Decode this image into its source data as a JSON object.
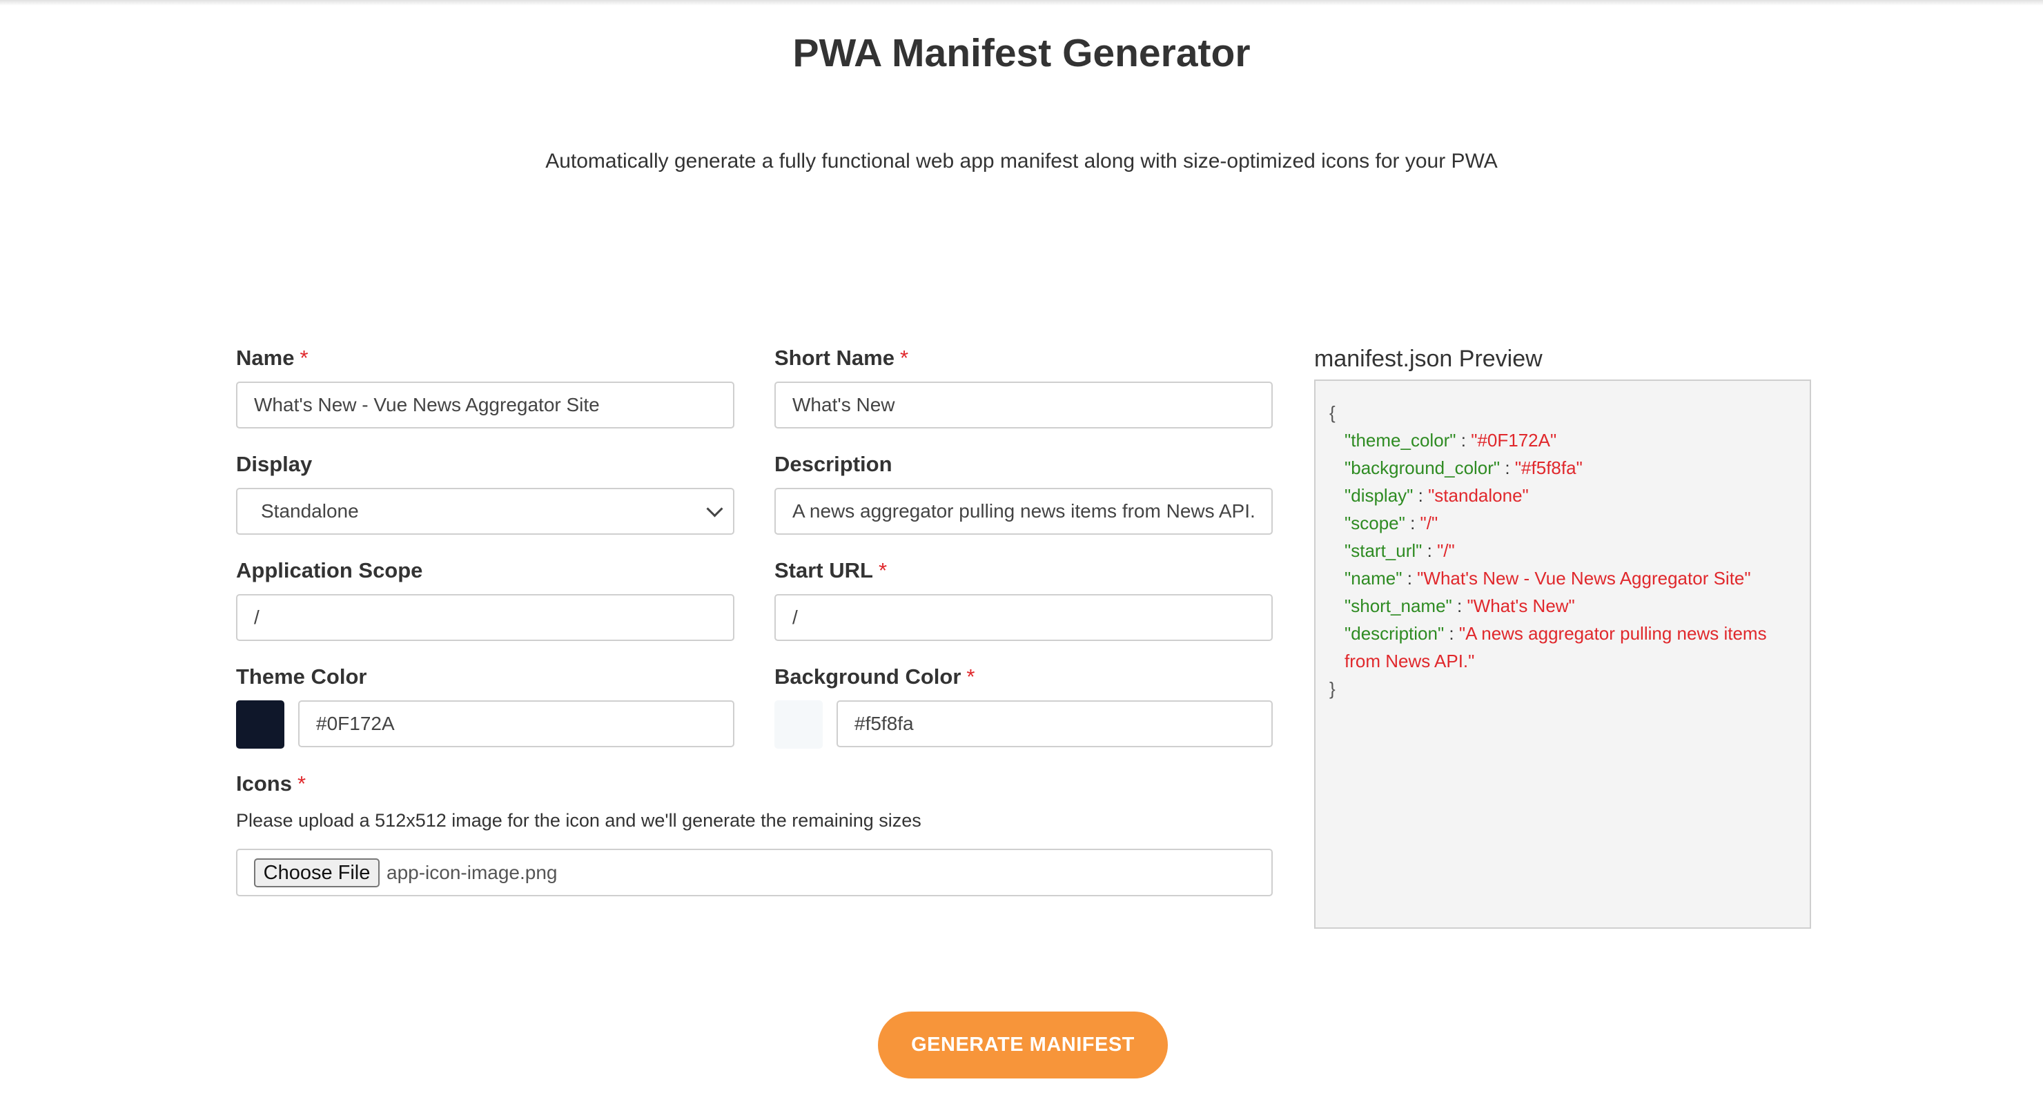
{
  "header": {
    "title": "PWA Manifest Generator",
    "subtitle": "Automatically generate a fully functional web app manifest along with size-optimized icons for your PWA"
  },
  "form": {
    "name": {
      "label": "Name",
      "required": "*",
      "value": "What's New - Vue News Aggregator Site"
    },
    "short_name": {
      "label": "Short Name",
      "required": "*",
      "value": "What's New"
    },
    "display": {
      "label": "Display",
      "value": "Standalone"
    },
    "description": {
      "label": "Description",
      "value": "A news aggregator pulling news items from News API."
    },
    "scope": {
      "label": "Application Scope",
      "value": "/"
    },
    "start_url": {
      "label": "Start URL",
      "required": "*",
      "value": "/"
    },
    "theme_color": {
      "label": "Theme Color",
      "value": "#0F172A",
      "swatch": "#0F172A"
    },
    "background_color": {
      "label": "Background Color",
      "required": "*",
      "value": "#f5f8fa",
      "swatch": "#f5f8fa"
    },
    "icons": {
      "label": "Icons",
      "required": "*",
      "hint": "Please upload a 512x512 image for the icon and we'll generate the remaining sizes",
      "button_label": "Choose File",
      "file_name": "app-icon-image.png"
    }
  },
  "preview": {
    "title": "manifest.json Preview",
    "open_brace": "{",
    "close_brace": "}",
    "entries": [
      {
        "key": "\"theme_color\"",
        "value": "\"#0F172A\""
      },
      {
        "key": "\"background_color\"",
        "value": "\"#f5f8fa\""
      },
      {
        "key": "\"display\"",
        "value": "\"standalone\""
      },
      {
        "key": "\"scope\"",
        "value": "\"/\""
      },
      {
        "key": "\"start_url\"",
        "value": "\"/\""
      },
      {
        "key": "\"name\"",
        "value": "\"What's New - Vue News Aggregator Site\""
      },
      {
        "key": "\"short_name\"",
        "value": "\"What's New\""
      },
      {
        "key": "\"description\"",
        "value": "\"A news aggregator pulling news items",
        "continuation": "from News API.\""
      }
    ]
  },
  "actions": {
    "generate_label": "GENERATE MANIFEST"
  },
  "colors": {
    "accent": "#f7953a",
    "required": "#e0282c",
    "json_key": "#2e8b22",
    "json_value": "#e0282c"
  }
}
